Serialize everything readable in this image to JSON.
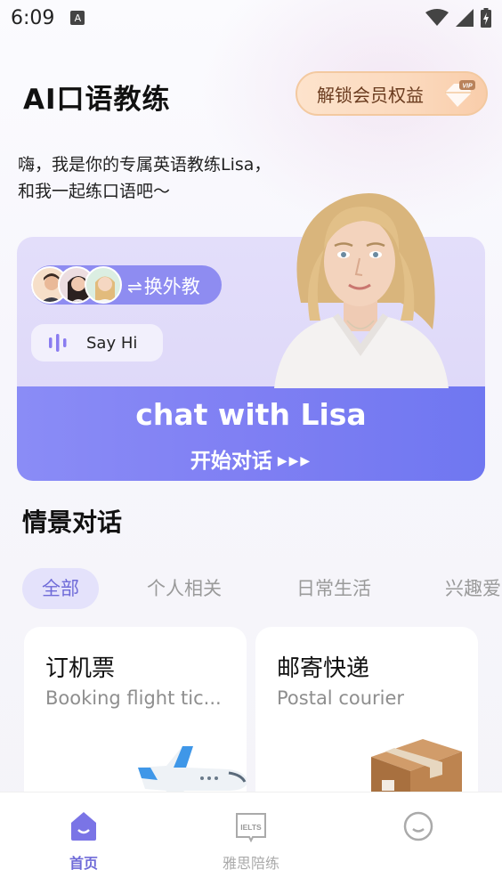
{
  "status_bar": {
    "time": "6:09",
    "notification_glyph": "A"
  },
  "header": {
    "title": "AI口语教练",
    "vip_label": "解锁会员权益",
    "vip_badge": "VIP"
  },
  "greeting": {
    "line1": "嗨，我是你的专属英语教练Lisa，",
    "line2": "和我一起练口语吧～"
  },
  "hero": {
    "switch_label": "换外教",
    "say_hi": "Say Hi",
    "chat_title": "chat with Lisa",
    "start_label": "开始对话",
    "start_arrows": "▶▶▶"
  },
  "scenes": {
    "title": "情景对话",
    "tabs": [
      "全部",
      "个人相关",
      "日常生活",
      "兴趣爱"
    ],
    "cards": [
      {
        "title": "订机票",
        "subtitle": "Booking flight tic..."
      },
      {
        "title": "邮寄快递",
        "subtitle": "Postal courier"
      }
    ]
  },
  "bottom_nav": {
    "items": [
      {
        "label": "首页",
        "icon": "home-icon"
      },
      {
        "label": "雅思陪练",
        "icon": "ielts-book-icon",
        "icon_text": "IELTS"
      },
      {
        "label": "",
        "icon": "profile-icon"
      }
    ]
  },
  "colors": {
    "accent": "#6f6bd8",
    "banner": "#7f7ff3",
    "vip_text": "#6a3b1e"
  }
}
